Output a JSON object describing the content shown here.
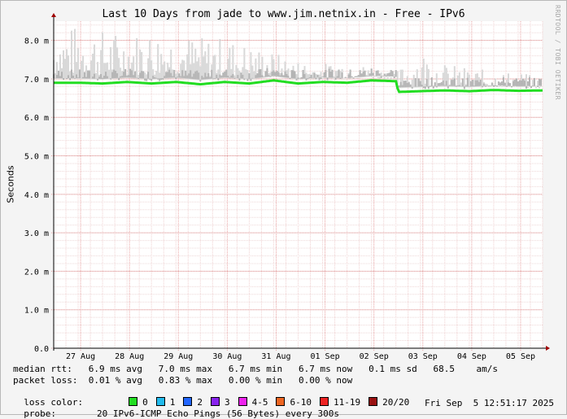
{
  "title": "Last 10 Days from jade to www.jim.netnix.in - Free - IPv6",
  "credit": "RRDTOOL / TOBI OETIKER",
  "chart_data": {
    "type": "area",
    "ylabel": "Seconds",
    "ylim": [
      0,
      0.0085
    ],
    "y_ticks": [
      {
        "v": 0.0,
        "label": "0.0"
      },
      {
        "v": 0.001,
        "label": "1.0 m"
      },
      {
        "v": 0.002,
        "label": "2.0 m"
      },
      {
        "v": 0.003,
        "label": "3.0 m"
      },
      {
        "v": 0.004,
        "label": "4.0 m"
      },
      {
        "v": 0.005,
        "label": "5.0 m"
      },
      {
        "v": 0.006,
        "label": "6.0 m"
      },
      {
        "v": 0.007,
        "label": "7.0 m"
      },
      {
        "v": 0.008,
        "label": "8.0 m"
      }
    ],
    "x_ticks": [
      "27 Aug",
      "28 Aug",
      "29 Aug",
      "30 Aug",
      "31 Aug",
      "01 Sep",
      "02 Sep",
      "03 Sep",
      "04 Sep",
      "05 Sep"
    ],
    "grid": true,
    "series": [
      {
        "name": "median rtt",
        "color": "#22dd22",
        "x_days": [
          0,
          0.5,
          1,
          1.5,
          2,
          2.5,
          3,
          3.5,
          4,
          4.5,
          5,
          5.5,
          6,
          6.5,
          7,
          7.05,
          7.5,
          8,
          8.5,
          9,
          9.5,
          10
        ],
        "values": [
          0.0069,
          0.0069,
          0.00688,
          0.00692,
          0.00688,
          0.00692,
          0.00686,
          0.00692,
          0.00688,
          0.00696,
          0.00688,
          0.00692,
          0.0069,
          0.00696,
          0.00694,
          0.00666,
          0.00668,
          0.0067,
          0.00668,
          0.00671,
          0.00669,
          0.0067
        ]
      },
      {
        "name": "max rtt",
        "color": "#d8d8d8",
        "x_days": [
          0,
          0.5,
          1,
          1.5,
          2,
          2.5,
          3,
          3.5,
          4,
          4.5,
          5,
          5.5,
          6,
          6.5,
          7,
          7.5,
          8,
          8.5,
          9,
          9.5,
          10
        ],
        "values": [
          0.0083,
          0.0084,
          0.0083,
          0.0082,
          0.0083,
          0.0082,
          0.0081,
          0.0081,
          0.0079,
          0.0077,
          0.0075,
          0.0074,
          0.0075,
          0.0073,
          0.0072,
          0.0078,
          0.0074,
          0.0073,
          0.0072,
          0.0072,
          0.007
        ]
      }
    ]
  },
  "stats": {
    "median_rtt": "median rtt:   6.9 ms avg   7.0 ms max   6.7 ms min   6.7 ms now   0.1 ms sd   68.5    am/s",
    "packet_loss": "packet loss:  0.01 % avg   0.83 % max   0.00 % min   0.00 % now",
    "loss_color_label": "loss color:",
    "loss_colors": [
      {
        "label": "0",
        "color": "#22dd22"
      },
      {
        "label": "1",
        "color": "#22bbee"
      },
      {
        "label": "2",
        "color": "#2266ff"
      },
      {
        "label": "3",
        "color": "#8822ee"
      },
      {
        "label": "4-5",
        "color": "#ee22ee"
      },
      {
        "label": "6-10",
        "color": "#ee6622"
      },
      {
        "label": "11-19",
        "color": "#ee2222"
      },
      {
        "label": "20/20",
        "color": "#991111"
      }
    ],
    "probe_label": "probe:",
    "probe_text": "20 IPv6-ICMP Echo Pings (56 Bytes) every 300s",
    "date": "Fri Sep  5 12:51:17 2025"
  }
}
